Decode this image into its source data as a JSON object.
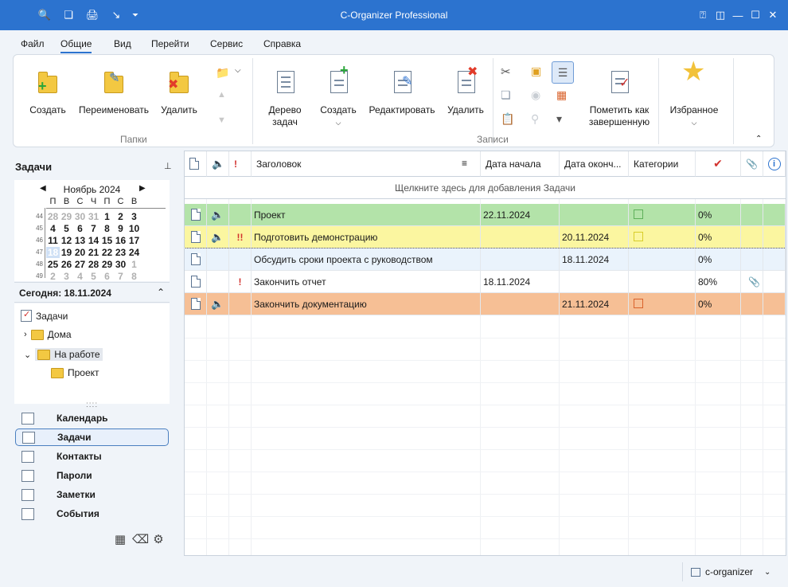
{
  "window": {
    "title": "C-Organizer Professional"
  },
  "menu": [
    "Файл",
    "Общие",
    "Вид",
    "Перейти",
    "Сервис",
    "Справка"
  ],
  "ribbon": {
    "folders": {
      "label": "Папки",
      "create": "Создать",
      "rename": "Переименовать",
      "delete": "Удалить"
    },
    "records": {
      "label": "Записи",
      "tree_line1": "Дерево",
      "tree_line2": "задач",
      "create": "Создать",
      "edit": "Редактировать",
      "delete": "Удалить",
      "mark_line1": "Пометить как",
      "mark_line2": "завершенную",
      "favorites": "Избранное"
    }
  },
  "left": {
    "header": "Задачи",
    "calendar": {
      "month": "Ноябрь 2024",
      "dow": [
        "П",
        "В",
        "С",
        "Ч",
        "П",
        "С",
        "В"
      ],
      "weeks": [
        {
          "wk": "44",
          "days": [
            "28",
            "29",
            "30",
            "31",
            "1",
            "2",
            "3"
          ]
        },
        {
          "wk": "45",
          "days": [
            "4",
            "5",
            "6",
            "7",
            "8",
            "9",
            "10"
          ]
        },
        {
          "wk": "46",
          "days": [
            "11",
            "12",
            "13",
            "14",
            "15",
            "16",
            "17"
          ]
        },
        {
          "wk": "47",
          "days": [
            "18",
            "19",
            "20",
            "21",
            "22",
            "23",
            "24"
          ]
        },
        {
          "wk": "48",
          "days": [
            "25",
            "26",
            "27",
            "28",
            "29",
            "30",
            "1"
          ]
        },
        {
          "wk": "49",
          "days": [
            "2",
            "3",
            "4",
            "5",
            "6",
            "7",
            "8"
          ]
        }
      ]
    },
    "today": "Сегодня: 18.11.2024",
    "tree": {
      "root": "Задачи",
      "home": "Дома",
      "work": "На работе",
      "project": "Проект"
    },
    "nav": [
      "Календарь",
      "Задачи",
      "Контакты",
      "Пароли",
      "Заметки",
      "События"
    ]
  },
  "grid": {
    "headers": {
      "title": "Заголовок",
      "start": "Дата начала",
      "end": "Дата оконч...",
      "categories": "Категории"
    },
    "add_hint": "Щелкните здесь для добавления Задачи",
    "rows": [
      {
        "title": "Проект",
        "start": "22.11.2024",
        "end": "",
        "progress": "0%",
        "priority": "",
        "bg": "#b3e3a9",
        "cat": "#5fb05a"
      },
      {
        "title": "Подготовить демонстрацию",
        "start": "",
        "end": "20.11.2024",
        "progress": "0%",
        "priority": "!!",
        "bg": "#fbf6a0",
        "cat": "#d8cd2a"
      },
      {
        "title": "Обсудить сроки проекта с руководством",
        "start": "",
        "end": "18.11.2024",
        "progress": "0%",
        "priority": "",
        "bg": "#eaf3fc",
        "cat": ""
      },
      {
        "title": "Закончить отчет",
        "start": "18.11.2024",
        "end": "",
        "progress": "80%",
        "priority": "!",
        "bg": "#ffffff",
        "cat": ""
      },
      {
        "title": "Закончить документацию",
        "start": "",
        "end": "21.11.2024",
        "progress": "0%",
        "priority": "",
        "bg": "#f6bf95",
        "cat": "#d9622b"
      }
    ]
  },
  "status": {
    "account": "c-organizer"
  }
}
